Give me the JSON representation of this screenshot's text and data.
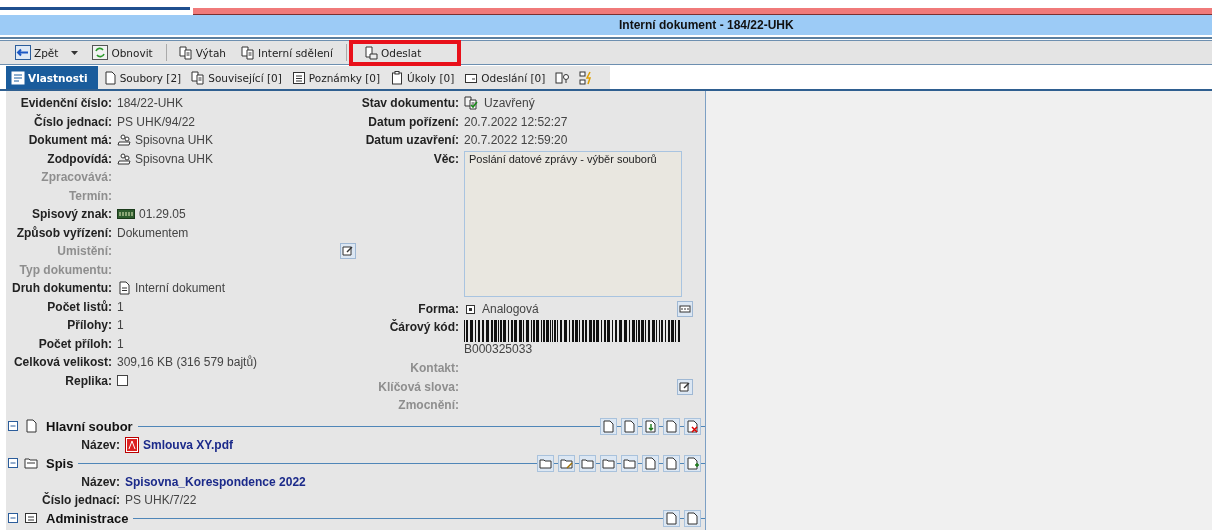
{
  "window": {
    "title": "Interní dokument - 184/22-UHK"
  },
  "toolbar": [
    {
      "label": "Zpět",
      "dropdown": true,
      "separator_after": false,
      "highlighted": false
    },
    {
      "label": "Obnovit",
      "dropdown": false,
      "separator_after": true,
      "highlighted": false
    },
    {
      "label": "Výtah",
      "dropdown": false,
      "separator_after": false,
      "highlighted": false
    },
    {
      "label": "Interní sdělení",
      "dropdown": false,
      "separator_after": true,
      "highlighted": false
    },
    {
      "label": "Odeslat",
      "dropdown": false,
      "separator_after": false,
      "highlighted": true
    }
  ],
  "tabs": [
    {
      "label": "Vlastnosti",
      "selected": true
    },
    {
      "label": "Soubory [2]",
      "selected": false
    },
    {
      "label": "Související [0]",
      "selected": false
    },
    {
      "label": "Poznámky [0]",
      "selected": false
    },
    {
      "label": "Úkoly [0]",
      "selected": false
    },
    {
      "label": "Odeslání [0]",
      "selected": false
    },
    {
      "selected": false
    },
    {
      "selected": false
    }
  ],
  "left_fields": [
    {
      "label": "Evidenční číslo:",
      "value": "184/22-UHK",
      "kind": "text",
      "disabled": false
    },
    {
      "label": "Číslo jednací:",
      "value": "PS UHK/94/22",
      "kind": "text",
      "disabled": false
    },
    {
      "label": "Dokument má:",
      "value": "Spisovna UHK",
      "kind": "user",
      "disabled": false
    },
    {
      "label": "Zodpovídá:",
      "value": "Spisovna UHK",
      "kind": "user",
      "disabled": false
    },
    {
      "label": "Zpracovává:",
      "kind": "text",
      "disabled": true
    },
    {
      "label": "Termín:",
      "kind": "text",
      "disabled": true
    },
    {
      "label": "Spisový znak:",
      "value": "01.29.05",
      "kind": "code",
      "disabled": false
    },
    {
      "label": "Způsob vyřízení:",
      "value": "Dokumentem",
      "kind": "text",
      "disabled": false
    },
    {
      "label": "Umistění:",
      "kind": "button",
      "disabled": true
    },
    {
      "label": "Typ dokumentu:",
      "kind": "text",
      "disabled": true
    },
    {
      "label": "Druh dokumentu:",
      "value": "Interní dokument",
      "kind": "doc",
      "disabled": false
    },
    {
      "label": "Počet listů:",
      "value": "1",
      "kind": "text",
      "disabled": false
    },
    {
      "label": "Přílohy:",
      "value": "1",
      "kind": "text",
      "disabled": false
    },
    {
      "label": "Počet příloh:",
      "value": "1",
      "kind": "text",
      "disabled": false
    },
    {
      "label": "Celková velikost:",
      "value": "309,16 KB (316 579 bajtů)",
      "kind": "text",
      "disabled": false
    },
    {
      "label": "Replika:",
      "kind": "checkbox",
      "checked": false,
      "disabled": false
    }
  ],
  "right_fields": [
    {
      "label": "Stav dokumentu:",
      "value": "Uzavřený",
      "kind": "status",
      "disabled": false
    },
    {
      "label": "Datum pořízení:",
      "value": "20.7.2022 12:52:27",
      "kind": "text",
      "disabled": false
    },
    {
      "label": "Datum uzavření:",
      "value": "20.7.2022 12:59:20",
      "kind": "text",
      "disabled": false
    },
    {
      "label": "Věc:",
      "value": "Poslání datové zprávy - výběr souborů",
      "kind": "textarea",
      "disabled": false
    },
    {
      "label": "Forma:",
      "value": "Analogová",
      "kind": "form",
      "disabled": false
    },
    {
      "label": "Čárový kód:",
      "value": "B000325033",
      "kind": "barcode",
      "disabled": false
    },
    {
      "label": "Kontakt:",
      "kind": "text",
      "disabled": true
    },
    {
      "label": "Klíčová slova:",
      "kind": "button",
      "disabled": true
    },
    {
      "label": "Zmocnění:",
      "kind": "text",
      "disabled": true
    }
  ],
  "sections": [
    {
      "title": "Hlavní soubor",
      "kind": "file",
      "expanded": true,
      "rows": [
        {
          "label": "Název:",
          "value": "Smlouva XY.pdf",
          "kind": "pdf"
        }
      ]
    },
    {
      "title": "Spis",
      "kind": "folder",
      "expanded": true,
      "rows": [
        {
          "label": "Název:",
          "value": "Spisovna_Korespondence 2022",
          "kind": "link"
        },
        {
          "label": "Číslo jednací:",
          "value": "PS UHK/7/22",
          "kind": "text"
        }
      ]
    },
    {
      "title": "Administrace",
      "kind": "admin",
      "expanded": true
    }
  ]
}
